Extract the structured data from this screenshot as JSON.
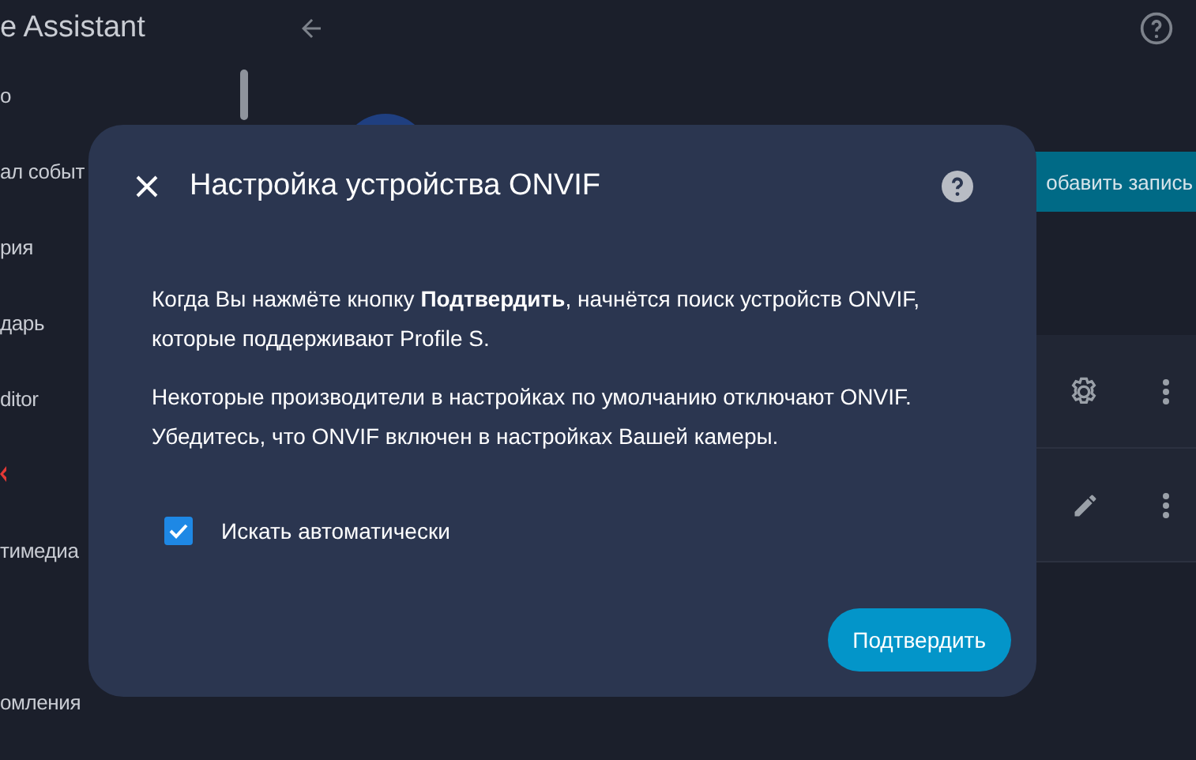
{
  "sidebar": {
    "title": "e Assistant",
    "items": [
      {
        "label": "о",
        "kind": "text"
      },
      {
        "label": "ал событ",
        "kind": "text"
      },
      {
        "label": "рия",
        "kind": "text"
      },
      {
        "label": "дарь",
        "kind": "text"
      },
      {
        "label": "ditor",
        "kind": "text"
      },
      {
        "kind": "mark"
      },
      {
        "label": "тимедиа",
        "kind": "text"
      },
      {
        "kind": "spacer"
      },
      {
        "label": "омления",
        "kind": "text"
      }
    ]
  },
  "main": {
    "add_button": "обавить запись",
    "rows": [
      {
        "kind": "settings"
      },
      {
        "kind": "edit"
      }
    ]
  },
  "dialog": {
    "title": "Настройка устройства ONVIF",
    "paragraphs": [
      "Когда Вы нажмёте кнопку **Подтвердить**, начнётся поиск устройств ONVIF, которые поддерживают Profile S.",
      "Некоторые производители в настройках по умолчанию отключают ONVIF. Убедитесь, что ONVIF включен в настройках Вашей камеры."
    ],
    "checkbox": {
      "label": "Искать автоматически",
      "checked": true
    },
    "submit": "Подтвердить"
  }
}
